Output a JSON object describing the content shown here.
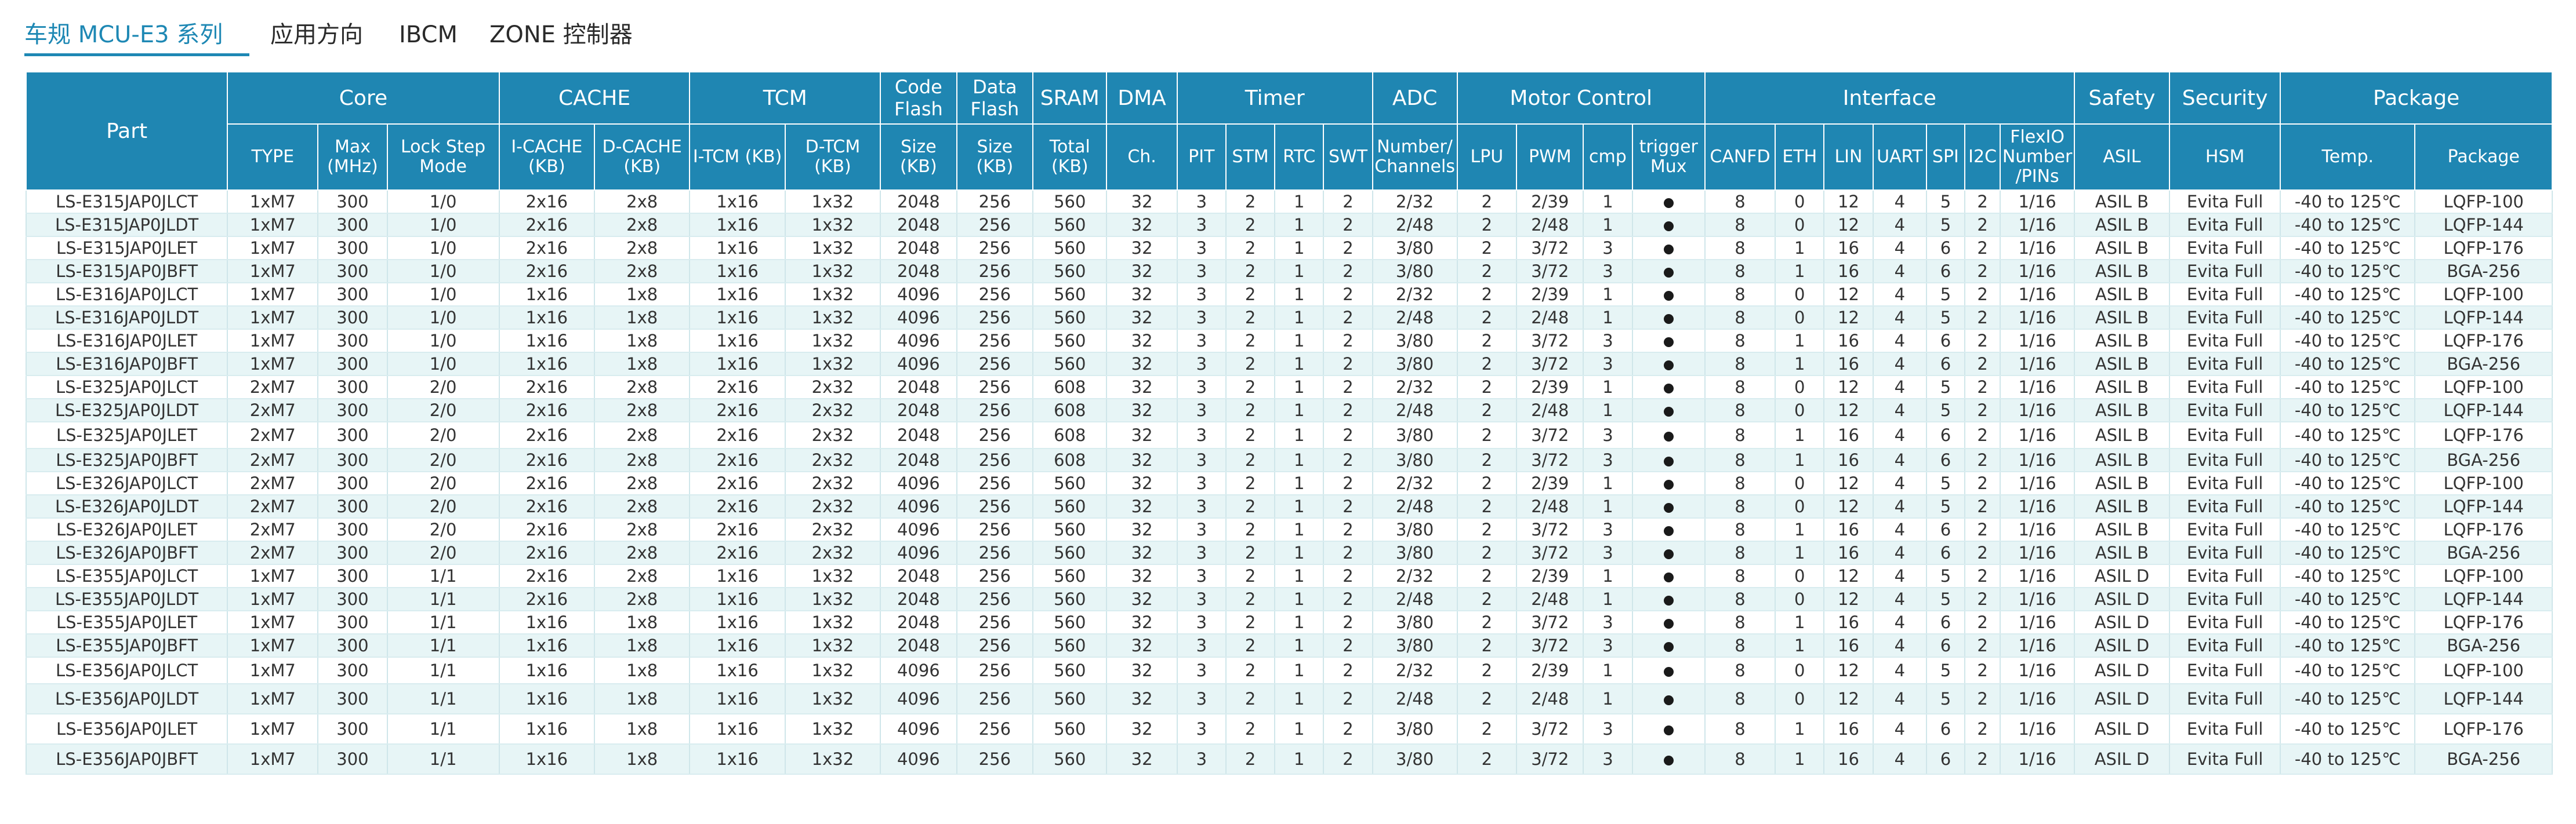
{
  "tabs": [
    {
      "label": "车规 MCU-E3 系列",
      "active": true
    },
    {
      "label": "应用方向",
      "active": false
    },
    {
      "label": "IBCM",
      "active": false
    },
    {
      "label": "ZONE 控制器",
      "active": false
    }
  ],
  "table": {
    "part_header": "Part",
    "groups": [
      {
        "label": "Core",
        "span": 3
      },
      {
        "label": "CACHE",
        "span": 2
      },
      {
        "label": "TCM",
        "span": 2
      },
      {
        "label": "Code Flash",
        "span": 1
      },
      {
        "label": "Data Flash",
        "span": 1
      },
      {
        "label": "SRAM",
        "span": 1
      },
      {
        "label": "DMA",
        "span": 1
      },
      {
        "label": "Timer",
        "span": 4
      },
      {
        "label": "ADC",
        "span": 1
      },
      {
        "label": "Motor Control",
        "span": 4
      },
      {
        "label": "Interface",
        "span": 7
      },
      {
        "label": "Safety",
        "span": 1
      },
      {
        "label": "Security",
        "span": 1
      },
      {
        "label": "Package",
        "span": 2
      }
    ],
    "subheaders": [
      "TYPE",
      "Max (MHz)",
      "Lock Step Mode",
      "I-CACHE (KB)",
      "D-CACHE (KB)",
      "I-TCM (KB)",
      "D-TCM (KB)",
      "Size (KB)",
      "Size (KB)",
      "Total (KB)",
      "Ch.",
      "PIT",
      "STM",
      "RTC",
      "SWT",
      "Number/ Channels",
      "LPU",
      "PWM",
      "cmp",
      "trigger Mux",
      "CANFD",
      "ETH",
      "LIN",
      "UART",
      "SPI",
      "I2C",
      "FlexIO Number /PINs",
      "ASIL",
      "HSM",
      "Temp.",
      "Package"
    ],
    "rows": [
      [
        "LS-E315JAP0JLCT",
        "1xM7",
        "300",
        "1/0",
        "2x16",
        "2x8",
        "1x16",
        "1x32",
        "2048",
        "256",
        "560",
        "32",
        "3",
        "2",
        "1",
        "2",
        "2/32",
        "2",
        "2/39",
        "1",
        "●",
        "8",
        "0",
        "12",
        "4",
        "5",
        "2",
        "1/16",
        "ASIL B",
        "Evita Full",
        "-40 to 125℃",
        "LQFP-100"
      ],
      [
        "LS-E315JAP0JLDT",
        "1xM7",
        "300",
        "1/0",
        "2x16",
        "2x8",
        "1x16",
        "1x32",
        "2048",
        "256",
        "560",
        "32",
        "3",
        "2",
        "1",
        "2",
        "2/48",
        "2",
        "2/48",
        "1",
        "●",
        "8",
        "0",
        "12",
        "4",
        "5",
        "2",
        "1/16",
        "ASIL B",
        "Evita Full",
        "-40 to 125℃",
        "LQFP-144"
      ],
      [
        "LS-E315JAP0JLET",
        "1xM7",
        "300",
        "1/0",
        "2x16",
        "2x8",
        "1x16",
        "1x32",
        "2048",
        "256",
        "560",
        "32",
        "3",
        "2",
        "1",
        "2",
        "3/80",
        "2",
        "3/72",
        "3",
        "●",
        "8",
        "1",
        "16",
        "4",
        "6",
        "2",
        "1/16",
        "ASIL B",
        "Evita Full",
        "-40 to 125℃",
        "LQFP-176"
      ],
      [
        "LS-E315JAP0JBFT",
        "1xM7",
        "300",
        "1/0",
        "2x16",
        "2x8",
        "1x16",
        "1x32",
        "2048",
        "256",
        "560",
        "32",
        "3",
        "2",
        "1",
        "2",
        "3/80",
        "2",
        "3/72",
        "3",
        "●",
        "8",
        "1",
        "16",
        "4",
        "6",
        "2",
        "1/16",
        "ASIL B",
        "Evita Full",
        "-40 to 125℃",
        "BGA-256"
      ],
      [
        "LS-E316JAP0JLCT",
        "1xM7",
        "300",
        "1/0",
        "1x16",
        "1x8",
        "1x16",
        "1x32",
        "4096",
        "256",
        "560",
        "32",
        "3",
        "2",
        "1",
        "2",
        "2/32",
        "2",
        "2/39",
        "1",
        "●",
        "8",
        "0",
        "12",
        "4",
        "5",
        "2",
        "1/16",
        "ASIL B",
        "Evita Full",
        "-40 to 125℃",
        "LQFP-100"
      ],
      [
        "LS-E316JAP0JLDT",
        "1xM7",
        "300",
        "1/0",
        "1x16",
        "1x8",
        "1x16",
        "1x32",
        "4096",
        "256",
        "560",
        "32",
        "3",
        "2",
        "1",
        "2",
        "2/48",
        "2",
        "2/48",
        "1",
        "●",
        "8",
        "0",
        "12",
        "4",
        "5",
        "2",
        "1/16",
        "ASIL B",
        "Evita Full",
        "-40 to 125℃",
        "LQFP-144"
      ],
      [
        "LS-E316JAP0JLET",
        "1xM7",
        "300",
        "1/0",
        "1x16",
        "1x8",
        "1x16",
        "1x32",
        "4096",
        "256",
        "560",
        "32",
        "3",
        "2",
        "1",
        "2",
        "3/80",
        "2",
        "3/72",
        "3",
        "●",
        "8",
        "1",
        "16",
        "4",
        "6",
        "2",
        "1/16",
        "ASIL B",
        "Evita Full",
        "-40 to 125℃",
        "LQFP-176"
      ],
      [
        "LS-E316JAP0JBFT",
        "1xM7",
        "300",
        "1/0",
        "1x16",
        "1x8",
        "1x16",
        "1x32",
        "4096",
        "256",
        "560",
        "32",
        "3",
        "2",
        "1",
        "2",
        "3/80",
        "2",
        "3/72",
        "3",
        "●",
        "8",
        "1",
        "16",
        "4",
        "6",
        "2",
        "1/16",
        "ASIL B",
        "Evita Full",
        "-40 to 125℃",
        "BGA-256"
      ],
      [
        "LS-E325JAP0JLCT",
        "2xM7",
        "300",
        "2/0",
        "2x16",
        "2x8",
        "2x16",
        "2x32",
        "2048",
        "256",
        "608",
        "32",
        "3",
        "2",
        "1",
        "2",
        "2/32",
        "2",
        "2/39",
        "1",
        "●",
        "8",
        "0",
        "12",
        "4",
        "5",
        "2",
        "1/16",
        "ASIL B",
        "Evita Full",
        "-40 to 125℃",
        "LQFP-100"
      ],
      [
        "LS-E325JAP0JLDT",
        "2xM7",
        "300",
        "2/0",
        "2x16",
        "2x8",
        "2x16",
        "2x32",
        "2048",
        "256",
        "608",
        "32",
        "3",
        "2",
        "1",
        "2",
        "2/48",
        "2",
        "2/48",
        "1",
        "●",
        "8",
        "0",
        "12",
        "4",
        "5",
        "2",
        "1/16",
        "ASIL B",
        "Evita Full",
        "-40 to 125℃",
        "LQFP-144"
      ],
      [
        "LS-E325JAP0JLET",
        "2xM7",
        "300",
        "2/0",
        "2x16",
        "2x8",
        "2x16",
        "2x32",
        "2048",
        "256",
        "608",
        "32",
        "3",
        "2",
        "1",
        "2",
        "3/80",
        "2",
        "3/72",
        "3",
        "●",
        "8",
        "1",
        "16",
        "4",
        "6",
        "2",
        "1/16",
        "ASIL B",
        "Evita Full",
        "-40 to 125℃",
        "LQFP-176"
      ],
      [
        "LS-E325JAP0JBFT",
        "2xM7",
        "300",
        "2/0",
        "2x16",
        "2x8",
        "2x16",
        "2x32",
        "2048",
        "256",
        "608",
        "32",
        "3",
        "2",
        "1",
        "2",
        "3/80",
        "2",
        "3/72",
        "3",
        "●",
        "8",
        "1",
        "16",
        "4",
        "6",
        "2",
        "1/16",
        "ASIL B",
        "Evita Full",
        "-40 to 125℃",
        "BGA-256"
      ],
      [
        "LS-E326JAP0JLCT",
        "2xM7",
        "300",
        "2/0",
        "2x16",
        "2x8",
        "2x16",
        "2x32",
        "4096",
        "256",
        "560",
        "32",
        "3",
        "2",
        "1",
        "2",
        "2/32",
        "2",
        "2/39",
        "1",
        "●",
        "8",
        "0",
        "12",
        "4",
        "5",
        "2",
        "1/16",
        "ASIL B",
        "Evita Full",
        "-40 to 125℃",
        "LQFP-100"
      ],
      [
        "LS-E326JAP0JLDT",
        "2xM7",
        "300",
        "2/0",
        "2x16",
        "2x8",
        "2x16",
        "2x32",
        "4096",
        "256",
        "560",
        "32",
        "3",
        "2",
        "1",
        "2",
        "2/48",
        "2",
        "2/48",
        "1",
        "●",
        "8",
        "0",
        "12",
        "4",
        "5",
        "2",
        "1/16",
        "ASIL B",
        "Evita Full",
        "-40 to 125℃",
        "LQFP-144"
      ],
      [
        "LS-E326JAP0JLET",
        "2xM7",
        "300",
        "2/0",
        "2x16",
        "2x8",
        "2x16",
        "2x32",
        "4096",
        "256",
        "560",
        "32",
        "3",
        "2",
        "1",
        "2",
        "3/80",
        "2",
        "3/72",
        "3",
        "●",
        "8",
        "1",
        "16",
        "4",
        "6",
        "2",
        "1/16",
        "ASIL B",
        "Evita Full",
        "-40 to 125℃",
        "LQFP-176"
      ],
      [
        "LS-E326JAP0JBFT",
        "2xM7",
        "300",
        "2/0",
        "2x16",
        "2x8",
        "2x16",
        "2x32",
        "4096",
        "256",
        "560",
        "32",
        "3",
        "2",
        "1",
        "2",
        "3/80",
        "2",
        "3/72",
        "3",
        "●",
        "8",
        "1",
        "16",
        "4",
        "6",
        "2",
        "1/16",
        "ASIL B",
        "Evita Full",
        "-40 to 125℃",
        "BGA-256"
      ],
      [
        "LS-E355JAP0JLCT",
        "1xM7",
        "300",
        "1/1",
        "2x16",
        "2x8",
        "1x16",
        "1x32",
        "2048",
        "256",
        "560",
        "32",
        "3",
        "2",
        "1",
        "2",
        "2/32",
        "2",
        "2/39",
        "1",
        "●",
        "8",
        "0",
        "12",
        "4",
        "5",
        "2",
        "1/16",
        "ASIL D",
        "Evita Full",
        "-40 to 125℃",
        "LQFP-100"
      ],
      [
        "LS-E355JAP0JLDT",
        "1xM7",
        "300",
        "1/1",
        "2x16",
        "2x8",
        "1x16",
        "1x32",
        "2048",
        "256",
        "560",
        "32",
        "3",
        "2",
        "1",
        "2",
        "2/48",
        "2",
        "2/48",
        "1",
        "●",
        "8",
        "0",
        "12",
        "4",
        "5",
        "2",
        "1/16",
        "ASIL D",
        "Evita Full",
        "-40 to 125℃",
        "LQFP-144"
      ],
      [
        "LS-E355JAP0JLET",
        "1xM7",
        "300",
        "1/1",
        "1x16",
        "1x8",
        "1x16",
        "1x32",
        "2048",
        "256",
        "560",
        "32",
        "3",
        "2",
        "1",
        "2",
        "3/80",
        "2",
        "3/72",
        "3",
        "●",
        "8",
        "1",
        "16",
        "4",
        "6",
        "2",
        "1/16",
        "ASIL D",
        "Evita Full",
        "-40 to 125℃",
        "LQFP-176"
      ],
      [
        "LS-E355JAP0JBFT",
        "1xM7",
        "300",
        "1/1",
        "1x16",
        "1x8",
        "1x16",
        "1x32",
        "2048",
        "256",
        "560",
        "32",
        "3",
        "2",
        "1",
        "2",
        "3/80",
        "2",
        "3/72",
        "3",
        "●",
        "8",
        "1",
        "16",
        "4",
        "6",
        "2",
        "1/16",
        "ASIL D",
        "Evita Full",
        "-40 to 125℃",
        "BGA-256"
      ],
      [
        "LS-E356JAP0JLCT",
        "1xM7",
        "300",
        "1/1",
        "1x16",
        "1x8",
        "1x16",
        "1x32",
        "4096",
        "256",
        "560",
        "32",
        "3",
        "2",
        "1",
        "2",
        "2/32",
        "2",
        "2/39",
        "1",
        "●",
        "8",
        "0",
        "12",
        "4",
        "5",
        "2",
        "1/16",
        "ASIL D",
        "Evita Full",
        "-40 to 125℃",
        "LQFP-100"
      ],
      [
        "LS-E356JAP0JLDT",
        "1xM7",
        "300",
        "1/1",
        "1x16",
        "1x8",
        "1x16",
        "1x32",
        "4096",
        "256",
        "560",
        "32",
        "3",
        "2",
        "1",
        "2",
        "2/48",
        "2",
        "2/48",
        "1",
        "●",
        "8",
        "0",
        "12",
        "4",
        "5",
        "2",
        "1/16",
        "ASIL D",
        "Evita Full",
        "-40 to 125℃",
        "LQFP-144"
      ],
      [
        "LS-E356JAP0JLET",
        "1xM7",
        "300",
        "1/1",
        "1x16",
        "1x8",
        "1x16",
        "1x32",
        "4096",
        "256",
        "560",
        "32",
        "3",
        "2",
        "1",
        "2",
        "3/80",
        "2",
        "3/72",
        "3",
        "●",
        "8",
        "1",
        "16",
        "4",
        "6",
        "2",
        "1/16",
        "ASIL D",
        "Evita Full",
        "-40 to 125℃",
        "LQFP-176"
      ],
      [
        "LS-E356JAP0JBFT",
        "1xM7",
        "300",
        "1/1",
        "1x16",
        "1x8",
        "1x16",
        "1x32",
        "4096",
        "256",
        "560",
        "32",
        "3",
        "2",
        "1",
        "2",
        "3/80",
        "2",
        "3/72",
        "3",
        "●",
        "8",
        "1",
        "16",
        "4",
        "6",
        "2",
        "1/16",
        "ASIL D",
        "Evita Full",
        "-40 to 125℃",
        "BGA-256"
      ]
    ]
  },
  "colors": {
    "accent": "#1e88b4",
    "header_bg": "#1f86b2",
    "stripe": "#e7f5f6"
  }
}
